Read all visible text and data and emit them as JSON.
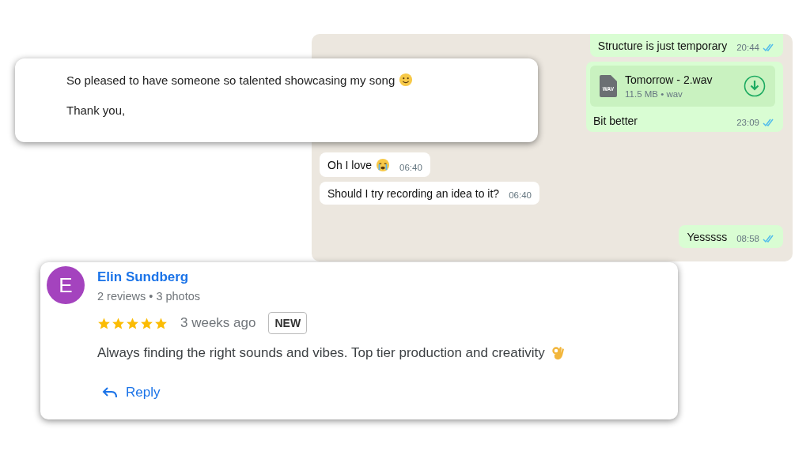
{
  "email": {
    "lines": [
      {
        "text": "So pleased to have someone so talented showcasing my song",
        "emoji": {
          "kind": "smile"
        }
      },
      {
        "text": "Thank you,"
      }
    ]
  },
  "chat": {
    "messages": [
      {
        "kind": "text",
        "outgoing": true,
        "text": "Structure is just temporary",
        "time": "20:44",
        "read": true
      },
      {
        "kind": "file",
        "outgoing": true,
        "file_badge": "WAV",
        "file_name": "Tomorrow - 2.wav",
        "file_info": "11.5 MB • wav",
        "text": "Bit better",
        "time": "23:09",
        "read": true
      },
      {
        "kind": "gap"
      },
      {
        "kind": "text",
        "outgoing": false,
        "text": "Oh I love",
        "emoji": {
          "kind": "crying"
        },
        "time": "06:40"
      },
      {
        "kind": "text",
        "outgoing": false,
        "text": "Should I try recording an idea to it?",
        "time": "06:40"
      },
      {
        "kind": "gap"
      },
      {
        "kind": "text",
        "outgoing": true,
        "text": "Yesssss",
        "time": "08:58",
        "read": true
      }
    ]
  },
  "review": {
    "avatar": {
      "letter": "E",
      "color": "#a443be"
    },
    "name": "Elin Sundberg",
    "meta": "2 reviews • 3 photos",
    "stars": 5,
    "time": "3 weeks ago",
    "badge": "NEW",
    "text": "Always finding the right sounds and vibes. Top tier production and creativity",
    "emoji": {
      "kind": "ok-hand"
    },
    "reply": "Reply"
  }
}
